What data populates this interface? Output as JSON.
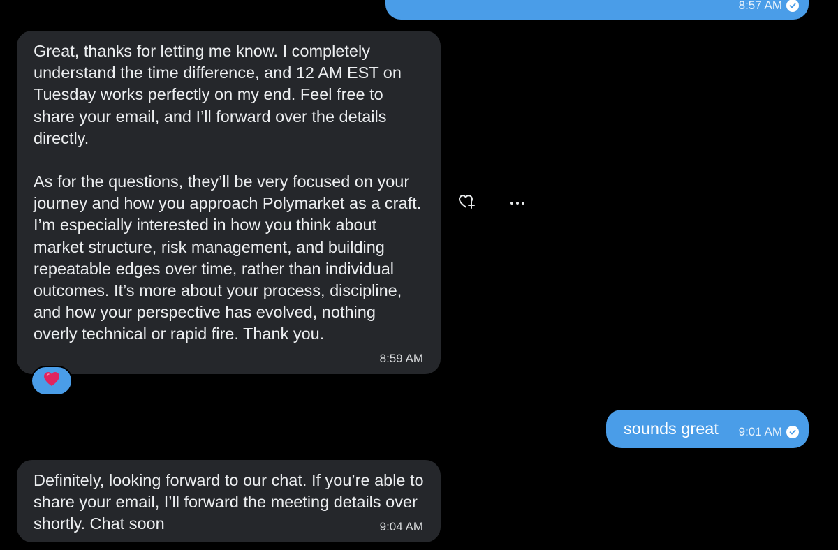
{
  "messages": {
    "top_outgoing": {
      "time": "8:57 AM",
      "status": "read"
    },
    "incoming_1": {
      "paragraph_1": "Great, thanks for letting me know. I completely understand the time difference, and 12 AM EST on Tuesday works perfectly on my end. Feel free to share your email, and I’ll forward over the details directly.",
      "paragraph_2": "As for the questions, they’ll be very focused on your journey and how you approach Polymarket as a craft. I’m especially interested in how you think about market structure, risk management, and building repeatable edges over time, rather than individual outcomes. It’s more about your process, discipline, and how your perspective has evolved, nothing overly technical or rapid fire. Thank you.",
      "time": "8:59 AM",
      "reaction": "red-heart"
    },
    "outgoing_2": {
      "text": "sounds great",
      "time": "9:01 AM",
      "status": "read"
    },
    "incoming_3": {
      "text": "Definitely, looking forward to our chat. If you’re able to share your email, I’ll forward the meeting details over shortly. Chat soon",
      "time": "9:04 AM"
    }
  },
  "actions": {
    "react_icon": "heart-plus-icon",
    "more_icon": "more-horizontal-icon"
  },
  "colors": {
    "background": "#000000",
    "incoming_bubble": "#25272b",
    "outgoing_bubble": "#4a9de8",
    "heart": "#e0245e"
  }
}
